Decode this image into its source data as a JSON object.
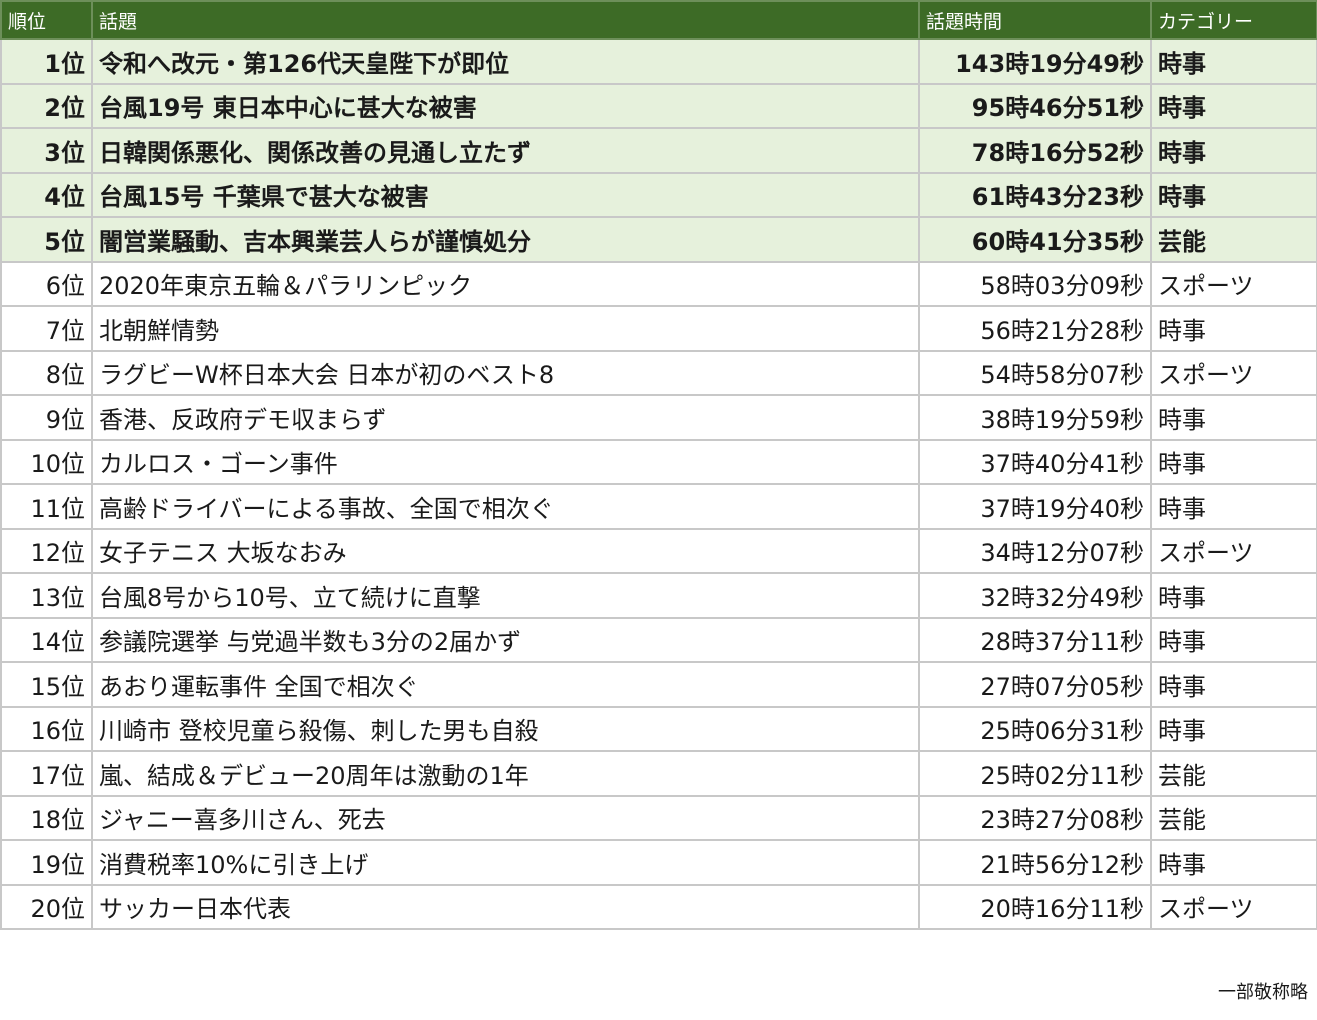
{
  "table": {
    "headers": {
      "rank": "順位",
      "topic": "話題",
      "time": "話題時間",
      "category": "カテゴリー"
    },
    "rows": [
      {
        "rank": "1位",
        "topic": "令和へ改元・第126代天皇陛下が即位",
        "time": "143時19分49秒",
        "category": "時事",
        "highlight": true
      },
      {
        "rank": "2位",
        "topic": "台風19号 東日本中心に甚大な被害",
        "time": "95時46分51秒",
        "category": "時事",
        "highlight": true
      },
      {
        "rank": "3位",
        "topic": "日韓関係悪化、関係改善の見通し立たず",
        "time": "78時16分52秒",
        "category": "時事",
        "highlight": true
      },
      {
        "rank": "4位",
        "topic": "台風15号 千葉県で甚大な被害",
        "time": "61時43分23秒",
        "category": "時事",
        "highlight": true
      },
      {
        "rank": "5位",
        "topic": "闇営業騒動、吉本興業芸人らが謹慎処分",
        "time": "60時41分35秒",
        "category": "芸能",
        "highlight": true
      },
      {
        "rank": "6位",
        "topic": "2020年東京五輪＆パラリンピック",
        "time": "58時03分09秒",
        "category": "スポーツ",
        "highlight": false
      },
      {
        "rank": "7位",
        "topic": "北朝鮮情勢",
        "time": "56時21分28秒",
        "category": "時事",
        "highlight": false
      },
      {
        "rank": "8位",
        "topic": "ラグビーW杯日本大会 日本が初のベスト8",
        "time": "54時58分07秒",
        "category": "スポーツ",
        "highlight": false
      },
      {
        "rank": "9位",
        "topic": "香港、反政府デモ収まらず",
        "time": "38時19分59秒",
        "category": "時事",
        "highlight": false
      },
      {
        "rank": "10位",
        "topic": "カルロス・ゴーン事件",
        "time": "37時40分41秒",
        "category": "時事",
        "highlight": false
      },
      {
        "rank": "11位",
        "topic": "高齢ドライバーによる事故、全国で相次ぐ",
        "time": "37時19分40秒",
        "category": "時事",
        "highlight": false
      },
      {
        "rank": "12位",
        "topic": "女子テニス 大坂なおみ",
        "time": "34時12分07秒",
        "category": "スポーツ",
        "highlight": false
      },
      {
        "rank": "13位",
        "topic": "台風8号から10号、立て続けに直撃",
        "time": "32時32分49秒",
        "category": "時事",
        "highlight": false
      },
      {
        "rank": "14位",
        "topic": "参議院選挙 与党過半数も3分の2届かず",
        "time": "28時37分11秒",
        "category": "時事",
        "highlight": false
      },
      {
        "rank": "15位",
        "topic": "あおり運転事件 全国で相次ぐ",
        "time": "27時07分05秒",
        "category": "時事",
        "highlight": false
      },
      {
        "rank": "16位",
        "topic": "川崎市 登校児童ら殺傷、刺した男も自殺",
        "time": "25時06分31秒",
        "category": "時事",
        "highlight": false
      },
      {
        "rank": "17位",
        "topic": "嵐、結成＆デビュー20周年は激動の1年",
        "time": "25時02分11秒",
        "category": "芸能",
        "highlight": false
      },
      {
        "rank": "18位",
        "topic": "ジャニー喜多川さん、死去",
        "time": "23時27分08秒",
        "category": "芸能",
        "highlight": false
      },
      {
        "rank": "19位",
        "topic": "消費税率10%に引き上げ",
        "time": "21時56分12秒",
        "category": "時事",
        "highlight": false
      },
      {
        "rank": "20位",
        "topic": "サッカー日本代表",
        "time": "20時16分11秒",
        "category": "スポーツ",
        "highlight": false
      }
    ]
  },
  "footnote": "一部敬称略",
  "colors": {
    "header_bg": "#3d6b26",
    "highlight_bg": "#e6f1dc",
    "border": "#c8c8c8"
  }
}
